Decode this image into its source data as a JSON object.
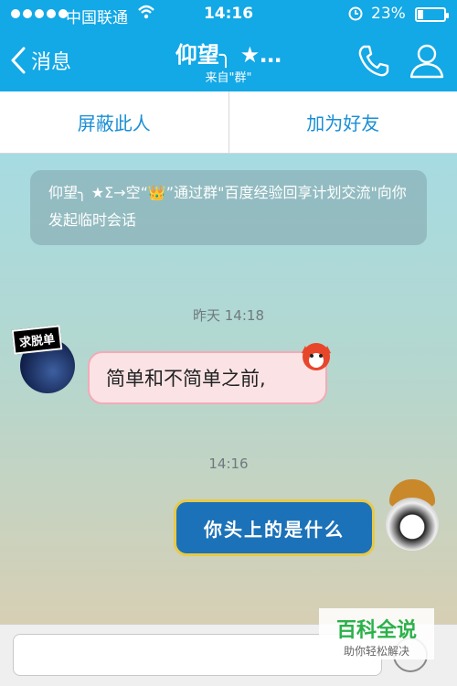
{
  "status_bar": {
    "carrier": "中国联通",
    "time": "14:16",
    "battery_percent": "23%",
    "battery_level": 0.23
  },
  "nav": {
    "back_label": "消息",
    "title": "仰望╮ ★…",
    "subtitle": "来自\"群\"",
    "icons": [
      "phone-icon",
      "profile-icon"
    ]
  },
  "actions": {
    "block": "屏蔽此人",
    "add_friend": "加为好友"
  },
  "chat": {
    "system_message": "仰望╮ ★Σ→空“👑”通过群\"百度经验回享计划交流\"向你发起临时会话",
    "timestamp_1": "昨天 14:18",
    "left_avatar_tag": "求脱单",
    "left_message": "简单和不简单之前,",
    "timestamp_2": "14:16",
    "right_message": "你头上的是什么"
  },
  "input": {
    "placeholder": ""
  },
  "watermark": {
    "title": "百科全说",
    "subtitle": "助你轻松解决"
  },
  "colors": {
    "nav_blue": "#13a8e6",
    "action_text": "#1a8fd6",
    "watermark_green": "#2bb14a"
  }
}
